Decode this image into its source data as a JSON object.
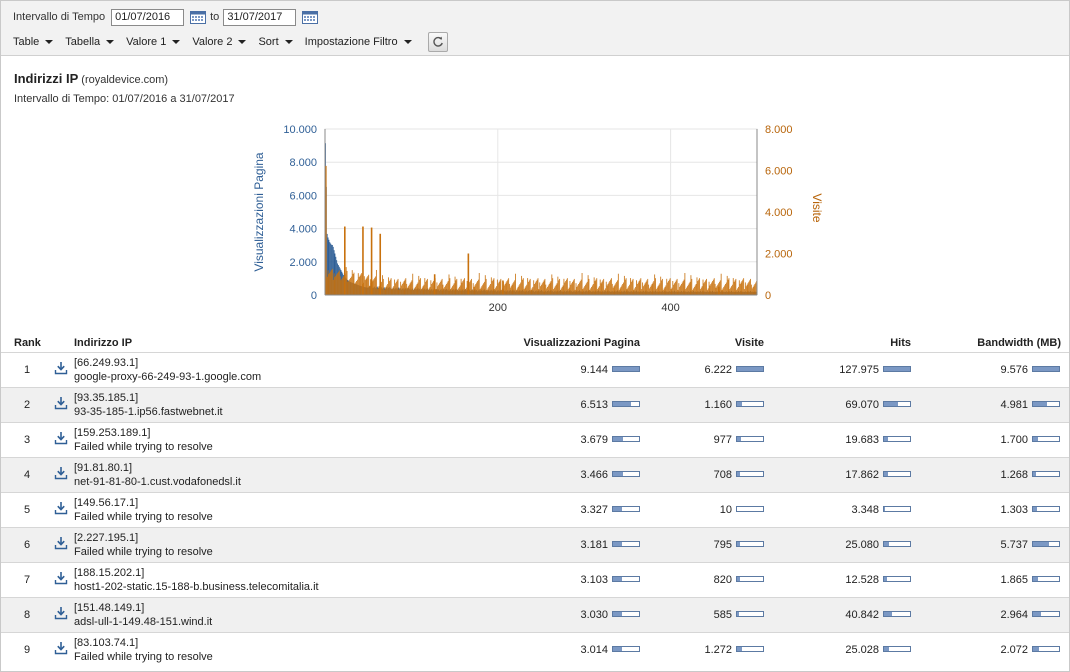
{
  "toolbar": {
    "interval_label": "Intervallo di Tempo",
    "date_from": "01/07/2016",
    "to_label": "to",
    "date_to": "31/07/2017",
    "menus": [
      "Table",
      "Tabella",
      "Valore 1",
      "Valore 2",
      "Sort",
      "Impostazione Filtro"
    ]
  },
  "report": {
    "title": "Indirizzi IP",
    "domain": "(royaldevice.com)",
    "range_text": "Intervallo di Tempo:  01/07/2016 a 31/07/2017"
  },
  "chart_data": {
    "type": "bar",
    "left_axis_label": "Visualizzazioni Pagina",
    "right_axis_label": "Visite",
    "left_ticks": [
      "10.000",
      "8.000",
      "6.000",
      "4.000",
      "2.000",
      "0"
    ],
    "right_ticks": [
      "8.000",
      "6.000",
      "4.000",
      "2.000",
      "0"
    ],
    "x_ticks": [
      "200",
      "400"
    ],
    "left_ylim": [
      0,
      10000
    ],
    "right_ylim": [
      0,
      8000
    ],
    "xlim": [
      0,
      500
    ],
    "colors": {
      "page_views": "#2f5f96",
      "visits": "#c8710d"
    },
    "page_views_sample": [
      9144,
      6513,
      3679,
      3466,
      3327,
      3181,
      3103,
      3030,
      3014,
      2900,
      2700,
      2500,
      2300,
      2100,
      1900,
      1800,
      1700,
      1600,
      1500,
      1400,
      1300,
      1200,
      1100,
      1050,
      1000,
      950,
      900,
      850,
      800,
      780,
      760,
      740,
      720,
      700,
      680,
      660,
      640,
      620,
      600,
      580,
      560,
      540,
      520,
      500,
      490,
      480,
      470,
      460,
      450,
      440
    ],
    "visits_spikes": [
      {
        "x": 0,
        "value": 6222
      },
      {
        "x": 22,
        "value": 3300
      },
      {
        "x": 43,
        "value": 3300
      },
      {
        "x": 53,
        "value": 3250
      },
      {
        "x": 63,
        "value": 2950
      },
      {
        "x": 126,
        "value": 1000
      },
      {
        "x": 165,
        "value": 2000
      },
      {
        "x": 205,
        "value": 700
      },
      {
        "x": 455,
        "value": 400
      }
    ]
  },
  "table": {
    "headers": {
      "rank": "Rank",
      "ip": "Indirizzo IP",
      "page_views": "Visualizzazioni Pagina",
      "visits": "Visite",
      "hits": "Hits",
      "bandwidth": "Bandwidth (MB)"
    },
    "rows": [
      {
        "rank": "1",
        "ip": "[66.249.93.1]",
        "host": "google-proxy-66-249-93-1.google.com",
        "page_views": "9.144",
        "pv_frac": 1.0,
        "visits": "6.222",
        "vis_frac": 1.0,
        "hits": "127.975",
        "hits_frac": 1.0,
        "bandwidth": "9.576",
        "bw_frac": 1.0
      },
      {
        "rank": "2",
        "ip": "[93.35.185.1]",
        "host": "93-35-185-1.ip56.fastwebnet.it",
        "page_views": "6.513",
        "pv_frac": 0.71,
        "visits": "1.160",
        "vis_frac": 0.19,
        "hits": "69.070",
        "hits_frac": 0.54,
        "bandwidth": "4.981",
        "bw_frac": 0.52
      },
      {
        "rank": "3",
        "ip": "[159.253.189.1]",
        "host": "Failed while trying to resolve",
        "page_views": "3.679",
        "pv_frac": 0.4,
        "visits": "977",
        "vis_frac": 0.16,
        "hits": "19.683",
        "hits_frac": 0.15,
        "bandwidth": "1.700",
        "bw_frac": 0.18
      },
      {
        "rank": "4",
        "ip": "[91.81.80.1]",
        "host": "net-91-81-80-1.cust.vodafonedsl.it",
        "page_views": "3.466",
        "pv_frac": 0.38,
        "visits": "708",
        "vis_frac": 0.11,
        "hits": "17.862",
        "hits_frac": 0.14,
        "bandwidth": "1.268",
        "bw_frac": 0.13
      },
      {
        "rank": "5",
        "ip": "[149.56.17.1]",
        "host": "Failed while trying to resolve",
        "page_views": "3.327",
        "pv_frac": 0.36,
        "visits": "10",
        "vis_frac": 0.0,
        "hits": "3.348",
        "hits_frac": 0.03,
        "bandwidth": "1.303",
        "bw_frac": 0.14
      },
      {
        "rank": "6",
        "ip": "[2.227.195.1]",
        "host": "Failed while trying to resolve",
        "page_views": "3.181",
        "pv_frac": 0.35,
        "visits": "795",
        "vis_frac": 0.13,
        "hits": "25.080",
        "hits_frac": 0.2,
        "bandwidth": "5.737",
        "bw_frac": 0.6
      },
      {
        "rank": "7",
        "ip": "[188.15.202.1]",
        "host": "host1-202-static.15-188-b.business.telecomitalia.it",
        "page_views": "3.103",
        "pv_frac": 0.34,
        "visits": "820",
        "vis_frac": 0.13,
        "hits": "12.528",
        "hits_frac": 0.1,
        "bandwidth": "1.865",
        "bw_frac": 0.19
      },
      {
        "rank": "8",
        "ip": "[151.48.149.1]",
        "host": "adsl-ull-1-149.48-151.wind.it",
        "page_views": "3.030",
        "pv_frac": 0.33,
        "visits": "585",
        "vis_frac": 0.09,
        "hits": "40.842",
        "hits_frac": 0.32,
        "bandwidth": "2.964",
        "bw_frac": 0.31
      },
      {
        "rank": "9",
        "ip": "[83.103.74.1]",
        "host": "Failed while trying to resolve",
        "page_views": "3.014",
        "pv_frac": 0.33,
        "visits": "1.272",
        "vis_frac": 0.2,
        "hits": "25.028",
        "hits_frac": 0.2,
        "bandwidth": "2.072",
        "bw_frac": 0.22
      }
    ]
  }
}
